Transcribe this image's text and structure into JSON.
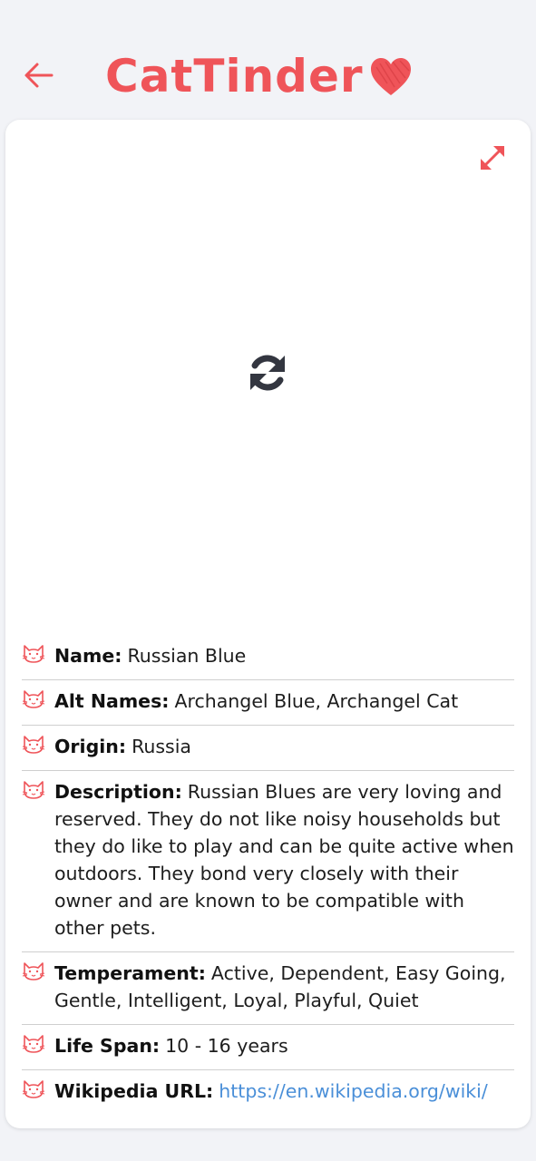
{
  "header": {
    "app_title": "CatTinder"
  },
  "colors": {
    "accent": "#ef5459",
    "link": "#4a8fd8",
    "background": "#f2f3f7"
  },
  "icons": {
    "back": "arrow-left-icon",
    "expand": "expand-icon",
    "loading": "refresh-icon",
    "row": "cat-face-icon",
    "logo": "heart-icon"
  },
  "breed": {
    "fields": [
      {
        "label": "Name:",
        "value": "Russian Blue"
      },
      {
        "label": "Alt Names:",
        "value": "Archangel Blue, Archangel Cat"
      },
      {
        "label": "Origin:",
        "value": "Russia"
      },
      {
        "label": "Description:",
        "value": "Russian Blues are very loving and reserved. They do not like noisy households but they do like to play and can be quite active when outdoors. They bond very closely with their owner and are known to be compatible with other pets."
      },
      {
        "label": "Temperament:",
        "value": "Active, Dependent, Easy Going, Gentle, Intelligent, Loyal, Playful, Quiet"
      },
      {
        "label": "Life Span:",
        "value": "10 - 16 years"
      },
      {
        "label": "Wikipedia URL:",
        "value": "https://en.wikipedia.org/wiki/"
      }
    ]
  }
}
